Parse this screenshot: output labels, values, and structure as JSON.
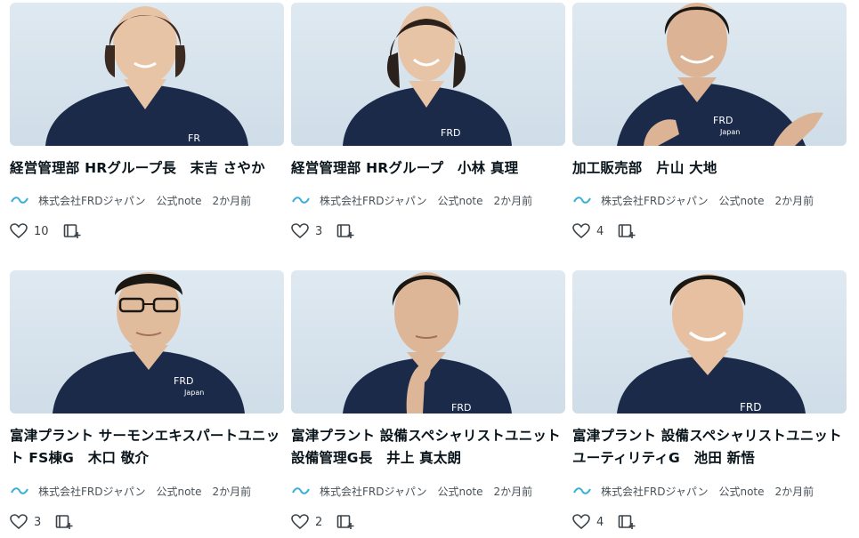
{
  "cards": [
    {
      "title": "経営管理部 HRグループ長　末吉 さやか",
      "author": "株式会社FRDジャパン",
      "source": "公式note",
      "time": "2か月前",
      "likes": "10"
    },
    {
      "title": "経営管理部 HRグループ　小林 真理",
      "author": "株式会社FRDジャパン",
      "source": "公式note",
      "time": "2か月前",
      "likes": "3"
    },
    {
      "title": "加工販売部　片山 大地",
      "author": "株式会社FRDジャパン",
      "source": "公式note",
      "time": "2か月前",
      "likes": "4"
    },
    {
      "title": "富津プラント サーモンエキスパートユニット FS棟G　木口 敬介",
      "author": "株式会社FRDジャパン",
      "source": "公式note",
      "time": "2か月前",
      "likes": "3"
    },
    {
      "title": "富津プラント 設備スペシャリストユニット 設備管理G長　井上 真太朗",
      "author": "株式会社FRDジャパン",
      "source": "公式note",
      "time": "2か月前",
      "likes": "2"
    },
    {
      "title": "富津プラント 設備スペシャリストユニット ユーティリティG　池田 新悟",
      "author": "株式会社FRDジャパン",
      "source": "公式note",
      "time": "2か月前",
      "likes": "4"
    }
  ],
  "colors": {
    "photo_bg": "#d6e3ed",
    "shirt": "#1c2a4a",
    "skin": "#e8c4a6",
    "hair": "#2a211c",
    "logo": "#3ab0d8"
  },
  "icons": {
    "like": "heart-icon",
    "save": "add-to-magazine-icon",
    "logo": "frd-logo-icon"
  }
}
